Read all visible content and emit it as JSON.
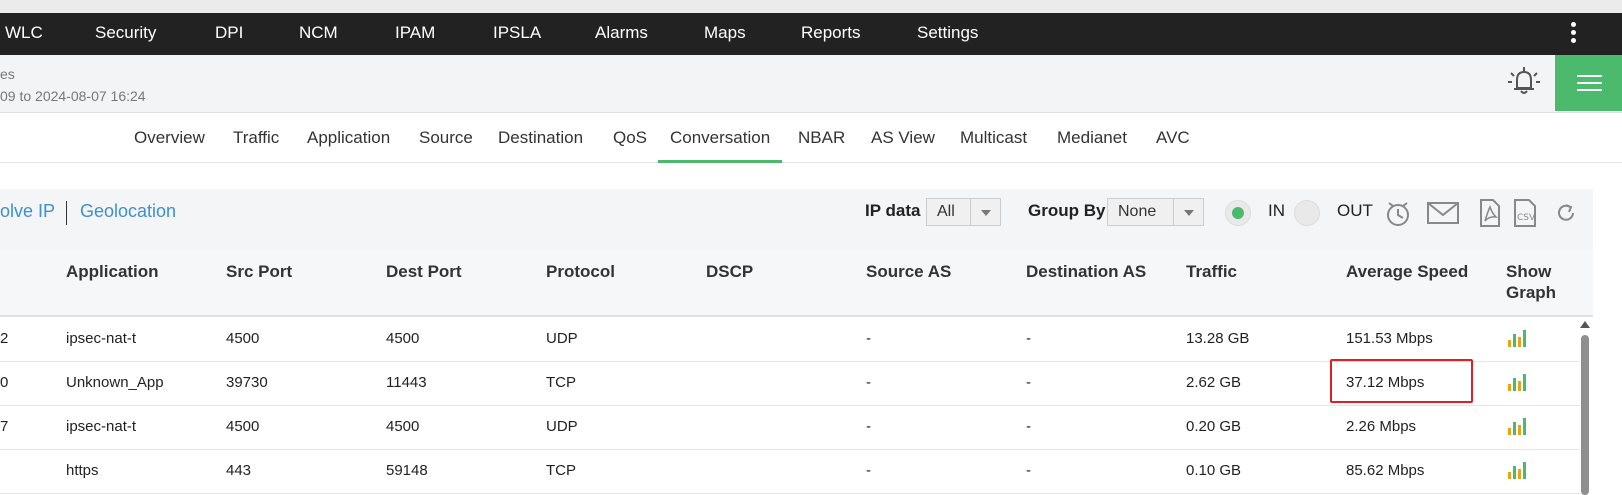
{
  "nav": {
    "items": [
      "WLC",
      "Security",
      "DPI",
      "NCM",
      "IPAM",
      "IPSLA",
      "Alarms",
      "Maps",
      "Reports",
      "Settings"
    ]
  },
  "subheader": {
    "line1": "es",
    "line2": "09 to 2024-08-07 16:24"
  },
  "tabs": [
    "Overview",
    "Traffic",
    "Application",
    "Source",
    "Destination",
    "QoS",
    "Conversation",
    "NBAR",
    "AS View",
    "Multicast",
    "Medianet",
    "AVC"
  ],
  "active_tab": "Conversation",
  "toolbar": {
    "resolve_ip": "olve IP",
    "geolocation": "Geolocation",
    "ip_data_label": "IP data",
    "ip_data_value": "All",
    "group_by_label": "Group By",
    "group_by_value": "None",
    "in_label": "IN",
    "out_label": "OUT",
    "selected_direction": "IN"
  },
  "table": {
    "headers": {
      "application": "Application",
      "src_port": "Src Port",
      "dest_port": "Dest Port",
      "protocol": "Protocol",
      "dscp": "DSCP",
      "source_as": "Source AS",
      "destination_as": "Destination AS",
      "traffic": "Traffic",
      "average_speed": "Average Speed",
      "show_graph_1": "Show",
      "show_graph_2": "Graph"
    },
    "rows": [
      {
        "prefix": "2",
        "application": "ipsec-nat-t",
        "src_port": "4500",
        "dest_port": "4500",
        "protocol": "UDP",
        "dscp": "",
        "source_as": "-",
        "destination_as": "-",
        "traffic": "13.28 GB",
        "average_speed": "151.53 Mbps"
      },
      {
        "prefix": "0",
        "application": "Unknown_App",
        "src_port": "39730",
        "dest_port": "11443",
        "protocol": "TCP",
        "dscp": "",
        "source_as": "-",
        "destination_as": "-",
        "traffic": "2.62 GB",
        "average_speed": "37.12 Mbps"
      },
      {
        "prefix": "7",
        "application": "ipsec-nat-t",
        "src_port": "4500",
        "dest_port": "4500",
        "protocol": "UDP",
        "dscp": "",
        "source_as": "-",
        "destination_as": "-",
        "traffic": "0.20 GB",
        "average_speed": "2.26 Mbps"
      },
      {
        "prefix": "",
        "application": "https",
        "src_port": "443",
        "dest_port": "59148",
        "protocol": "TCP",
        "dscp": "",
        "source_as": "-",
        "destination_as": "-",
        "traffic": "0.10 GB",
        "average_speed": "85.62 Mbps"
      }
    ]
  },
  "colors": {
    "accent": "#4cba6c",
    "link": "#3d8fd6",
    "highlight": "#e02020",
    "navbar": "#222222"
  },
  "icons": [
    "kebab-menu-icon",
    "bell-icon",
    "hamburger-menu-icon",
    "schedule-icon",
    "email-icon",
    "pdf-icon",
    "csv-icon",
    "refresh-icon",
    "bar-chart-icon"
  ]
}
